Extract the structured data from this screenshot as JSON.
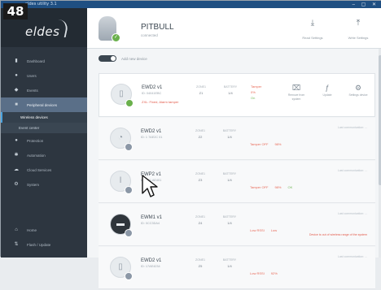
{
  "step_badge": "48",
  "window": {
    "title": "eldes utility 3.1"
  },
  "sidebar": {
    "logo": "eldes",
    "items": [
      {
        "label": "Dashboard",
        "icon": "chart-icon"
      },
      {
        "label": "Users",
        "icon": "user-icon"
      },
      {
        "label": "Events",
        "icon": "bell-icon"
      },
      {
        "label": "Peripheral devices",
        "icon": "device-icon"
      }
    ],
    "subitems": [
      {
        "label": "Wireless devices"
      },
      {
        "label": "Event center"
      }
    ],
    "items2": [
      {
        "label": "Protection",
        "icon": "shield-icon"
      },
      {
        "label": "Automation",
        "icon": "gear-icon"
      },
      {
        "label": "Cloud Services",
        "icon": "cloud-icon"
      },
      {
        "label": "System",
        "icon": "cog-icon"
      }
    ],
    "bottom": [
      {
        "label": "Home",
        "icon": "home-icon"
      },
      {
        "label": "Flash / Update",
        "icon": "flash-icon"
      }
    ]
  },
  "header": {
    "device_name": "PITBULL",
    "device_sub": "connected",
    "buttons": [
      {
        "label": "Read Settings",
        "icon": "download-icon"
      },
      {
        "label": "Write Settings",
        "icon": "upload-icon"
      }
    ]
  },
  "toggle": {
    "label": "Add new device"
  },
  "devices": [
    {
      "name": "EWD2 v1",
      "serial": "ID: 04041EBC",
      "warning": "ZXL: Fixed, Alarm tamper",
      "col1_head": "ZONE1",
      "col1_val": "Z1",
      "col2_head": "BATTERY",
      "col2_val": "1/4",
      "stack": [
        "Tamper",
        "0%",
        "On"
      ],
      "tools": [
        {
          "label": "Remove from system",
          "icon": "remove-icon"
        },
        {
          "label": "Update",
          "icon": "update-icon"
        },
        {
          "label": "Settings device",
          "icon": "settings-icon"
        }
      ],
      "status_color": "#6ab04c"
    },
    {
      "name": "EWD2 v1",
      "serial": "ID: 1 7AE2C 01",
      "col1_head": "ZONE1",
      "col1_val": "Z2",
      "col2_head": "BATTERY",
      "col2_val": "1/4",
      "signal1": "Tamper OFF",
      "signal2": "98%",
      "right_note": "Last communication: ...",
      "status_color": "#8b97a6"
    },
    {
      "name": "EWP2 v1",
      "serial": "ID: 0 11 AE401",
      "col1_head": "ZONE1",
      "col1_val": "Z3",
      "col2_head": "BATTERY",
      "col2_val": "1/4",
      "signal1": "Tamper OFF",
      "signal2": "98%",
      "signal3": "OK",
      "right_note": "Last communication: ...",
      "status_color": "#8b97a6"
    },
    {
      "name": "EWM1 v1",
      "serial": "ID: 0CC3DA4",
      "col1_head": "ZONE1",
      "col1_val": "Z4",
      "col2_head": "BATTERY",
      "col2_val": "1/4",
      "signal1": "Low RSSI",
      "signal2": "Low",
      "right_note": "Last communication: ...",
      "red_note": "Device is out of wireless range of the system",
      "status_color": "#8b97a6"
    },
    {
      "name": "EWD2 v1",
      "serial": "ID: 17AE4234",
      "col1_head": "ZONE1",
      "col1_val": "Z5",
      "col2_head": "BATTERY",
      "col2_val": "1/4",
      "signal1": "Low RSSI",
      "signal2": "92%",
      "right_note": "Last communication: ...",
      "status_color": "#8b97a6"
    }
  ]
}
